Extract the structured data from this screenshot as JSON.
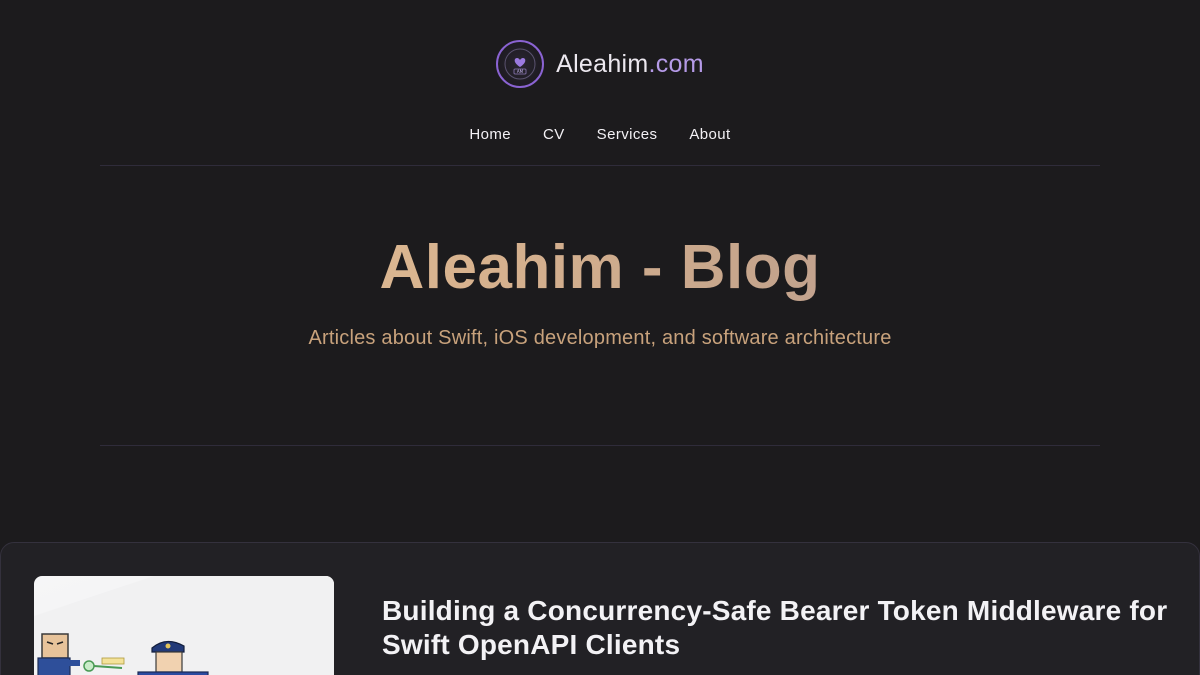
{
  "brand": {
    "logo_icon": "heart-emblem-icon",
    "name_main": "Aleahim",
    "name_tld": ".com"
  },
  "nav": {
    "items": [
      {
        "label": "Home"
      },
      {
        "label": "CV"
      },
      {
        "label": "Services"
      },
      {
        "label": "About"
      }
    ]
  },
  "hero": {
    "title": "Aleahim - Blog",
    "subtitle": "Articles about Swift, iOS development, and software architecture"
  },
  "posts": [
    {
      "title": "Building a Concurrency-Safe Bearer Token Middleware for Swift OpenAPI Clients",
      "thumbnail_icon": "cartoon-illustration-icon"
    }
  ],
  "colors": {
    "background": "#1c1b1d",
    "accent_purple": "#b59ae8",
    "hero_gradient_start": "#e6c79e",
    "hero_gradient_end": "#b696a6",
    "subtitle": "#c8a27c"
  }
}
